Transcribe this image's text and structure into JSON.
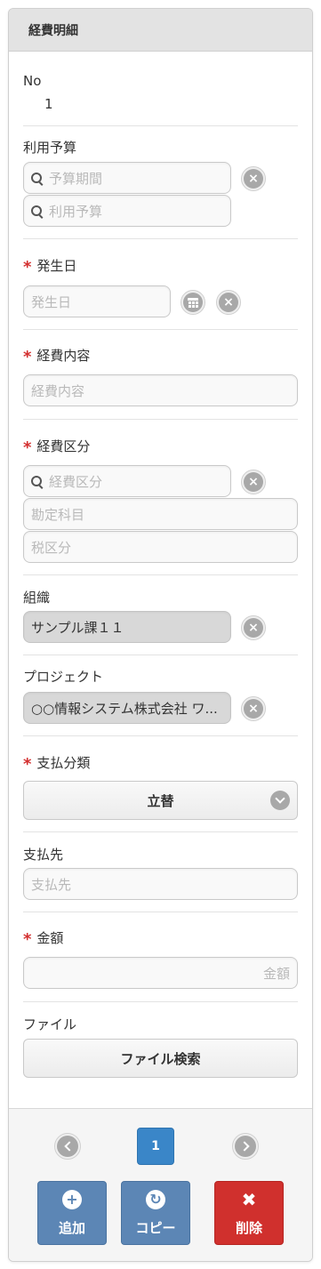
{
  "panel": {
    "title": "経費明細"
  },
  "no": {
    "label": "No",
    "value": "1"
  },
  "budget": {
    "label": "利用予算",
    "period_placeholder": "予算期間",
    "budget_placeholder": "利用予算"
  },
  "date": {
    "label": "発生日",
    "placeholder": "発生日",
    "required_mark": "*"
  },
  "content": {
    "label": "経費内容",
    "placeholder": "経費内容",
    "required_mark": "*"
  },
  "category": {
    "label": "経費区分",
    "placeholder": "経費区分",
    "account_placeholder": "勘定科目",
    "tax_placeholder": "税区分",
    "required_mark": "*"
  },
  "organization": {
    "label": "組織",
    "value": "サンプル課１１"
  },
  "project": {
    "label": "プロジェクト",
    "value": "○○情報システム株式会社 ワ..."
  },
  "payment_type": {
    "label": "支払分類",
    "value": "立替",
    "required_mark": "*"
  },
  "payee": {
    "label": "支払先",
    "placeholder": "支払先"
  },
  "amount": {
    "label": "金額",
    "placeholder": "金額",
    "required_mark": "*"
  },
  "file": {
    "label": "ファイル",
    "button_label": "ファイル検索"
  },
  "pager": {
    "current_page": "1"
  },
  "actions": {
    "add_label": "追加",
    "copy_label": "コピー",
    "delete_label": "削除"
  },
  "icons": {
    "clear": "×",
    "add": "+",
    "copy": "↻",
    "delete": "✖"
  },
  "colors": {
    "required": "#d32f2f",
    "primary": "#3a86c8",
    "action_blue": "#5c86b5",
    "danger": "#d0302d"
  }
}
